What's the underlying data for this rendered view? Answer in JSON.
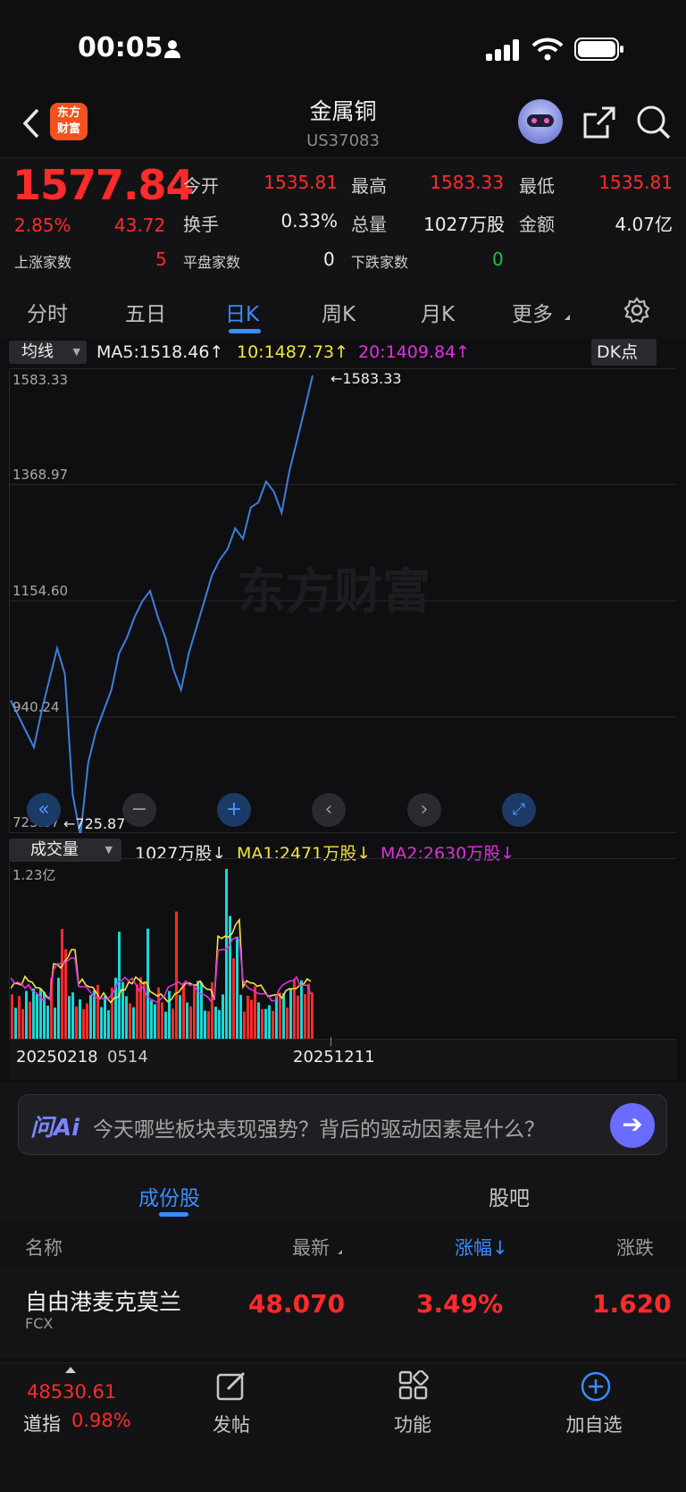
{
  "status_bar": {
    "time": "00:05"
  },
  "header": {
    "title": "金属铜",
    "code": "US37083",
    "logo_line1": "东方",
    "logo_line2": "财富"
  },
  "quote": {
    "price": "1577.84",
    "change_pct": "2.85%",
    "change": "43.72",
    "open_label": "今开",
    "open": "1535.81",
    "high_label": "最高",
    "high": "1583.33",
    "low_label": "最低",
    "low": "1535.81",
    "turnover_label": "换手",
    "turnover": "0.33%",
    "volume_label": "总量",
    "volume": "1027万股",
    "amount_label": "金额",
    "amount": "4.07亿",
    "up_label": "上涨家数",
    "up": "5",
    "flat_label": "平盘家数",
    "flat": "0",
    "down_label": "下跌家数",
    "down": "0"
  },
  "tabs": [
    "分时",
    "五日",
    "日K",
    "周K",
    "月K",
    "更多"
  ],
  "ma": {
    "selector": "均线",
    "ma5": "MA5:1518.46↑",
    "ma10": "10:1487.73↑",
    "ma20": "20:1409.84↑",
    "dk": "DK点"
  },
  "price_chart": {
    "y_ticks": [
      "1583.33",
      "1368.97",
      "1154.60",
      "940.24",
      "725.87"
    ],
    "max_label": "←1583.33",
    "min_label": "←725.87",
    "watermark": "东方财富"
  },
  "volume_header": {
    "selector": "成交量",
    "vol": "1027万股↓",
    "ma1": "MA1:2471万股↓",
    "ma2": "MA2:2630万股↓",
    "y_max": "1.23亿"
  },
  "x_labels": {
    "start": "20250218",
    "mid": "0514",
    "end": "20251211"
  },
  "ai": {
    "logo": "问Ai",
    "placeholder": "今天哪些板块表现强势？背后的驱动因素是什么？"
  },
  "section_tabs": {
    "components": "成份股",
    "forum": "股吧"
  },
  "table": {
    "headers": {
      "name": "名称",
      "latest": "最新",
      "change_pct": "涨幅↓",
      "change": "涨跌"
    },
    "rows": [
      {
        "name": "自由港麦克莫兰",
        "code": "FCX",
        "latest": "48.070",
        "change_pct": "3.49%",
        "change": "1.620"
      }
    ]
  },
  "bottom_nav": {
    "index_value": "48530.61",
    "index_name": "道指",
    "index_pct": "0.98%",
    "post": "发帖",
    "functions": "功能",
    "add_watch": "加自选"
  },
  "chart_data": {
    "type": "line",
    "ylim": [
      725.87,
      1583.33
    ],
    "values": [
      960,
      930,
      900,
      870,
      940,
      1000,
      1060,
      1010,
      780,
      700,
      840,
      900,
      940,
      980,
      1050,
      1080,
      1120,
      1150,
      1170,
      1120,
      1080,
      1020,
      980,
      1050,
      1100,
      1150,
      1200,
      1230,
      1250,
      1290,
      1270,
      1330,
      1340,
      1380,
      1360,
      1320,
      1400,
      1460,
      1520,
      1583.33
    ]
  }
}
